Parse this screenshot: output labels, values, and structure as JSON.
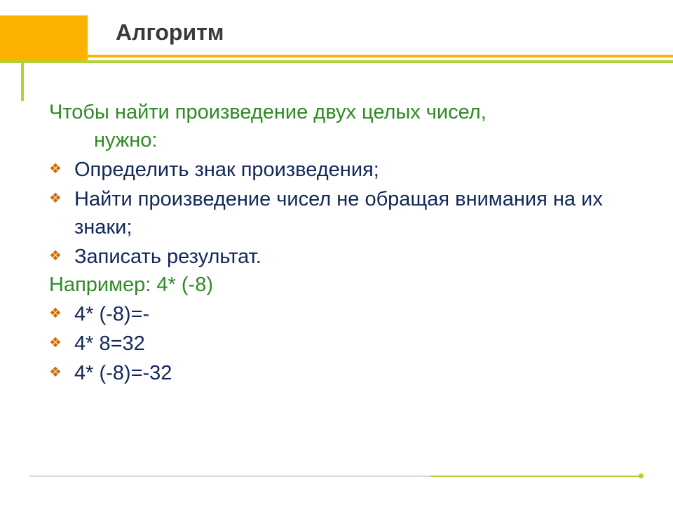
{
  "title": "Алгоритм",
  "intro_line1": "Чтобы найти произведение двух целых чисел,",
  "intro_line2": "нужно:",
  "steps": [
    "Определить знак произведения;",
    "Найти произведение чисел не обращая внимания на их знаки;",
    "Записать результат."
  ],
  "example_label": "Например: 4* (-8)",
  "example_lines": [
    "4* (-8)=-",
    "4* 8=32",
    "4* (-8)=-32"
  ]
}
